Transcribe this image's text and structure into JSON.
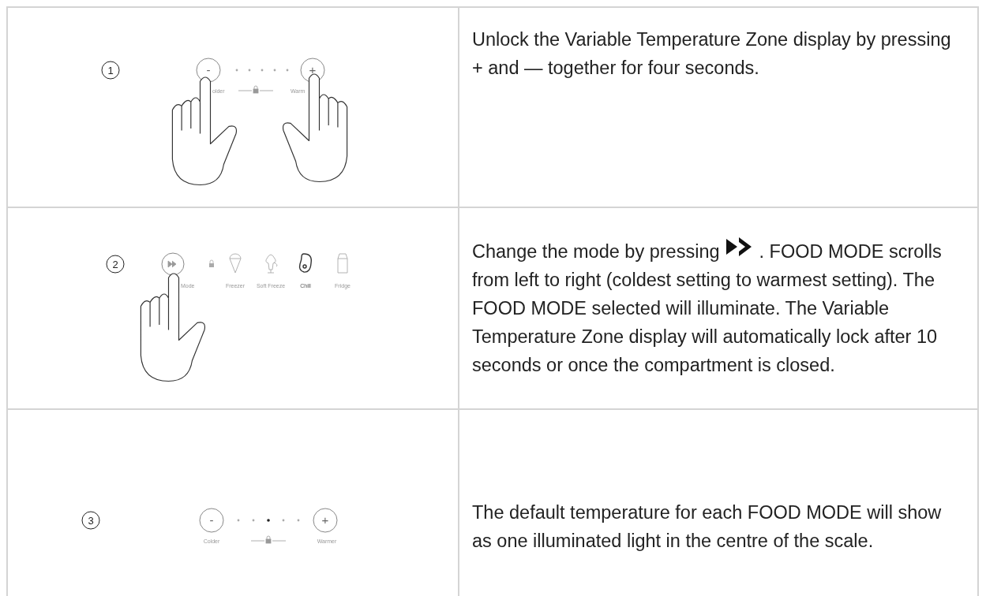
{
  "steps": [
    {
      "number": "1",
      "illustration": {
        "kind": "unlock",
        "minus": "-",
        "plus": "+",
        "left_label": "older",
        "right_label": "Warm",
        "dots": [
          {
            "lit": false
          },
          {
            "lit": false
          },
          {
            "lit": false
          },
          {
            "lit": false
          },
          {
            "lit": false
          }
        ]
      },
      "text": [
        "Unlock the Variable Temperature Zone display by pressing + and — together for four seconds."
      ]
    },
    {
      "number": "2",
      "illustration": {
        "kind": "modes",
        "mode_label": "Mode",
        "modes": [
          {
            "kind": "freezer",
            "label": "Freezer",
            "selected": false
          },
          {
            "kind": "soft_freeze",
            "label": "Soft Freeze",
            "selected": false
          },
          {
            "kind": "chill",
            "label": "Chill",
            "selected": true
          },
          {
            "kind": "fridge",
            "label": "Fridge",
            "selected": false
          }
        ]
      },
      "text": [
        "Change the mode by pressing",
        ". FOOD MODE scrolls from left to right (coldest setting to warmest setting). The FOOD MODE selected will illuminate. The Variable Temperature Zone display will automatically lock after 10 seconds or once the compartment is closed."
      ]
    },
    {
      "number": "3",
      "illustration": {
        "kind": "scale",
        "minus": "-",
        "plus": "+",
        "left_label": "Colder",
        "right_label": "Warmer",
        "dots": [
          {
            "lit": false
          },
          {
            "lit": false
          },
          {
            "lit": true
          },
          {
            "lit": false
          },
          {
            "lit": false
          }
        ]
      },
      "text": [
        "The default temperature for each FOOD MODE will show as one illuminated light in the centre of the scale."
      ]
    }
  ]
}
